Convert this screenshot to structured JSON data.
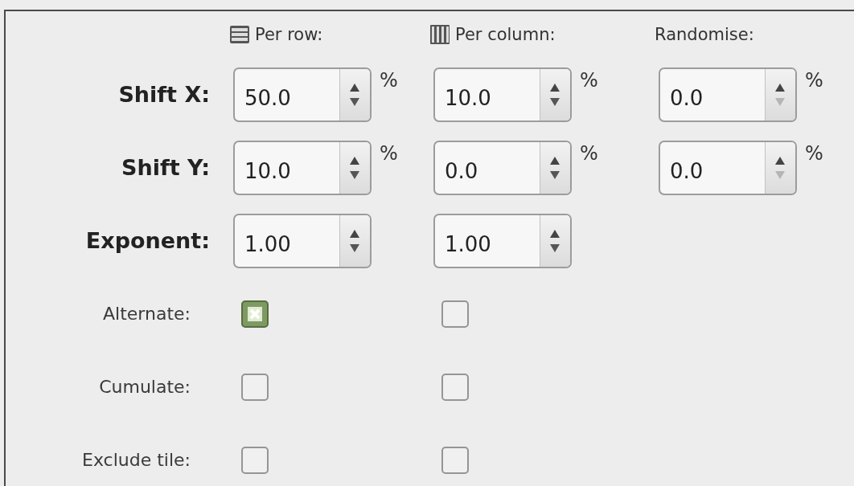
{
  "columns": [
    {
      "kind": "rows",
      "label": "Per row:"
    },
    {
      "kind": "columns",
      "label": "Per column:"
    },
    {
      "kind": "plain",
      "label": "Randomise:"
    }
  ],
  "rows": [
    {
      "kind": "spin",
      "label": "Shift X:",
      "cells": [
        {
          "value": "50.0",
          "unit": "%",
          "down_disabled": false
        },
        {
          "value": "10.0",
          "unit": "%",
          "down_disabled": false
        },
        {
          "value": "0.0",
          "unit": "%",
          "down_disabled": true
        }
      ]
    },
    {
      "kind": "spin",
      "label": "Shift Y:",
      "cells": [
        {
          "value": "10.0",
          "unit": "%",
          "down_disabled": false
        },
        {
          "value": "0.0",
          "unit": "%",
          "down_disabled": false
        },
        {
          "value": "0.0",
          "unit": "%",
          "down_disabled": true
        }
      ]
    },
    {
      "kind": "spin",
      "label": "Exponent:",
      "cells": [
        {
          "value": "1.00",
          "down_disabled": false
        },
        {
          "value": "1.00",
          "down_disabled": false
        }
      ]
    },
    {
      "kind": "check",
      "label": "Alternate:",
      "cells": [
        {
          "checked": true
        },
        {
          "checked": false
        }
      ]
    },
    {
      "kind": "check",
      "label": "Cumulate:",
      "cells": [
        {
          "checked": false
        },
        {
          "checked": false
        }
      ]
    },
    {
      "kind": "check",
      "label": "Exclude tile:",
      "cells": [
        {
          "checked": false
        },
        {
          "checked": false
        }
      ]
    }
  ]
}
